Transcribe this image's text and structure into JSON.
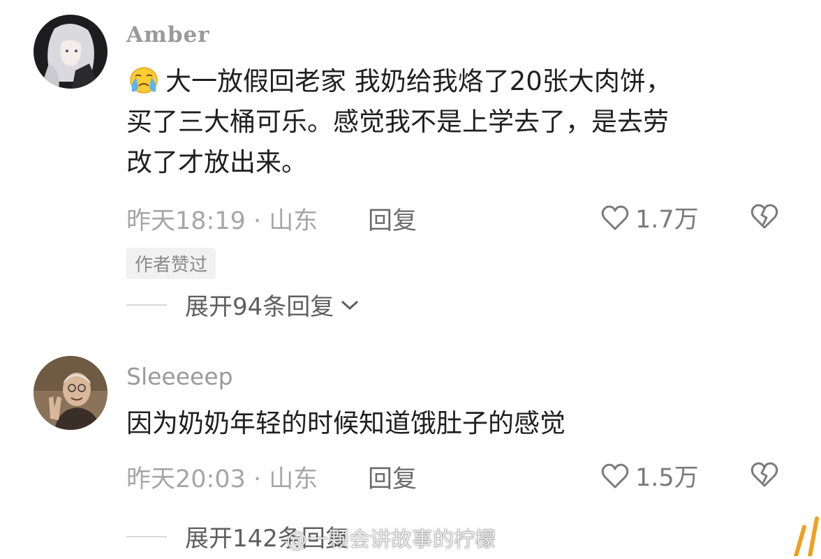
{
  "comments": [
    {
      "username": "Amber",
      "text_line1": "大一放假回老家 我奶给我烙了20张大肉饼，",
      "text_line2": "买了三大桶可乐。感觉我不是上学去了，是去劳",
      "text_line3": "改了才放出来。",
      "time_location": "昨天18:19 · 山东",
      "reply_label": "回复",
      "likes": "1.7万",
      "author_badge": "作者赞过",
      "expand_label": "展开94条回复"
    },
    {
      "username": "Sleeeeep",
      "text_line1": "因为奶奶年轻的时候知道饿肚子的感觉",
      "time_location": "昨天20:03 · 山东",
      "reply_label": "回复",
      "likes": "1.5万",
      "expand_label": "展开142条回复"
    }
  ],
  "watermark": "@一颗会讲故事的柠檬",
  "icons": {
    "emoji": "crying-face-icon",
    "like": "heart-outline-icon",
    "dislike": "broken-heart-icon",
    "expand": "chevron-down-icon"
  },
  "colors": {
    "text": "#1f1f1f",
    "meta": "#a6a6a6",
    "badge_bg": "#f1f1f1"
  }
}
